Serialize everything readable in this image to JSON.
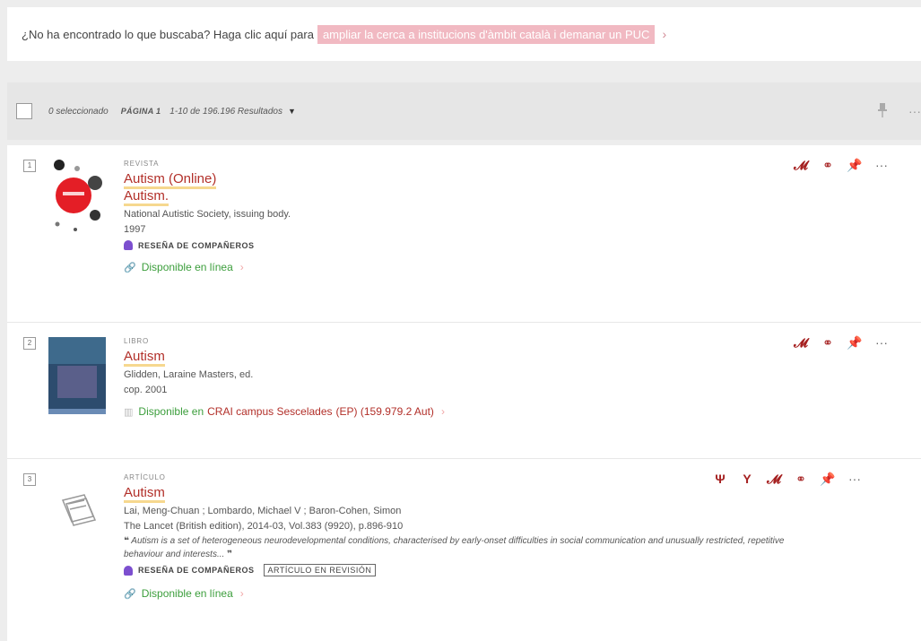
{
  "banner": {
    "prefix": "¿No ha encontrado lo que buscaba? Haga clic aquí para",
    "link": "ampliar la cerca a institucions d'àmbit català i demanar un PUC",
    "chevron": "›"
  },
  "toolbar": {
    "selected": "0 seleccionado",
    "page": "PÁGINA 1",
    "range": "1-10 de 196.196 Resultados",
    "caret": "▼",
    "pin_icon": "pin-icon",
    "more": "···"
  },
  "results": [
    {
      "num": "1",
      "type": "REVISTA",
      "title": "Autism (Online)",
      "subtitle": "Autism.",
      "lines": [
        "National Autistic Society, issuing body.",
        "1997"
      ],
      "peer": "RESEÑA DE COMPAÑEROS",
      "availability": "Disponible en línea",
      "chevron": "›"
    },
    {
      "num": "2",
      "type": "LIBRO",
      "title": "Autism",
      "lines": [
        "Glidden, Laraine Masters, ed.",
        "cop. 2001"
      ],
      "availability_prefix": "Disponible en",
      "availability_loc": "CRAI campus Sescelades",
      "availability_call": "(EP) (159.979.2 Aut)",
      "chevron": "›"
    },
    {
      "num": "3",
      "type": "ARTÍCULO",
      "title": "Autism",
      "lines": [
        "Lai, Meng-Chuan ; Lombardo, Michael V ; Baron-Cohen, Simon",
        "The Lancet (British edition), 2014-03, Vol.383 (9920), p.896-910"
      ],
      "quote": "Autism is a set of heterogeneous neurodevelopmental conditions, characterised by early-onset difficulties in social communication and unusually restricted, repetitive behaviour and interests...",
      "quote_mark": "❝",
      "quote_end": "❞",
      "peer": "RESEÑA DE COMPAÑEROS",
      "badge": "ARTÍCULO EN REVISIÓN",
      "availability": "Disponible en línea",
      "chevron": "›"
    }
  ],
  "icons": {
    "citation": "citation-icon",
    "link": "link-icon",
    "pin": "pin-icon",
    "more": "···",
    "cited": "Ψ",
    "citing": "Y"
  }
}
